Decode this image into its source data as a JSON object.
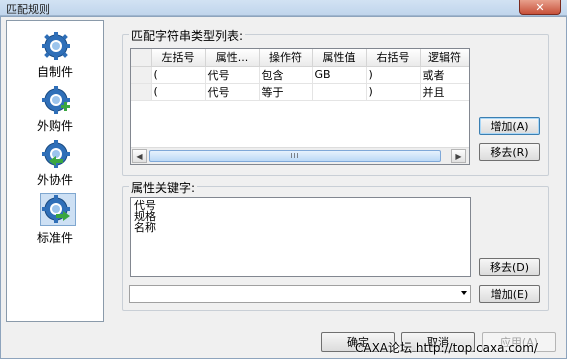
{
  "window": {
    "title": "匹配规则",
    "close_label": "✕"
  },
  "sidebar": {
    "items": [
      {
        "label": "自制件",
        "icon": "gear-icon"
      },
      {
        "label": "外购件",
        "icon": "gear-add-icon"
      },
      {
        "label": "外协件",
        "icon": "gear-arrow-left-icon"
      },
      {
        "label": "标准件",
        "icon": "gear-arrow-right-icon",
        "selected": true
      }
    ]
  },
  "type_group": {
    "title": "匹配字符串类型列表:",
    "columns": [
      "左括号",
      "属性...",
      "操作符",
      "属性值",
      "右括号",
      "逻辑符"
    ],
    "rows": [
      [
        "(",
        "代号",
        "包含",
        "GB",
        ")",
        "或者"
      ],
      [
        "(",
        "代号",
        "等于",
        "",
        ")",
        "并且"
      ]
    ],
    "scroll_grip": "III",
    "add_button": "增加(A)",
    "remove_button": "移去(R)"
  },
  "keyword_group": {
    "title": "属性关键字:",
    "items": [
      "代号",
      "规格",
      "名称"
    ],
    "remove_button": "移去(D)",
    "add_button": "增加(E)",
    "combo_value": ""
  },
  "footer": {
    "ok": "确定",
    "cancel": "取消",
    "apply": "应用(A)"
  },
  "watermark": "CAXA论坛 http://top.caxa.com/",
  "colors": {
    "accent": "#3c7fb1",
    "gear_blue": "#2f6fb8",
    "arrow_green": "#3aa640"
  }
}
